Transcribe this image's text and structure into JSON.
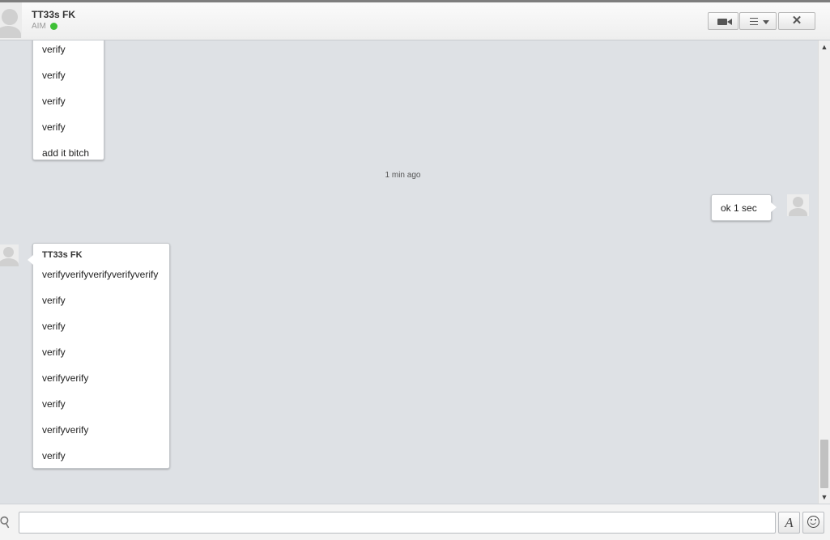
{
  "header": {
    "contact_name": "TT33s FK",
    "service": "AIM",
    "status_color": "#3ec036"
  },
  "conversation": {
    "earlier_block": {
      "messages": [
        "verify",
        "verify",
        "verify",
        "verify",
        "add it bitch"
      ]
    },
    "timestamp": "1 min ago",
    "outgoing_message": "ok 1 sec",
    "incoming_block": {
      "sender": "TT33s FK",
      "messages": [
        "verifyverifyverifyverifyverify",
        "verify",
        "verify",
        "verify",
        "verifyverify",
        "verify",
        "verifyverify",
        "verify"
      ]
    }
  },
  "composer": {
    "value": "",
    "placeholder": ""
  },
  "icons": {
    "video": "video-camera-icon",
    "menu": "list-menu-icon",
    "close": "close-icon",
    "attach": "paperclip-icon",
    "font": "font-style-icon",
    "emoji": "smiley-icon"
  }
}
